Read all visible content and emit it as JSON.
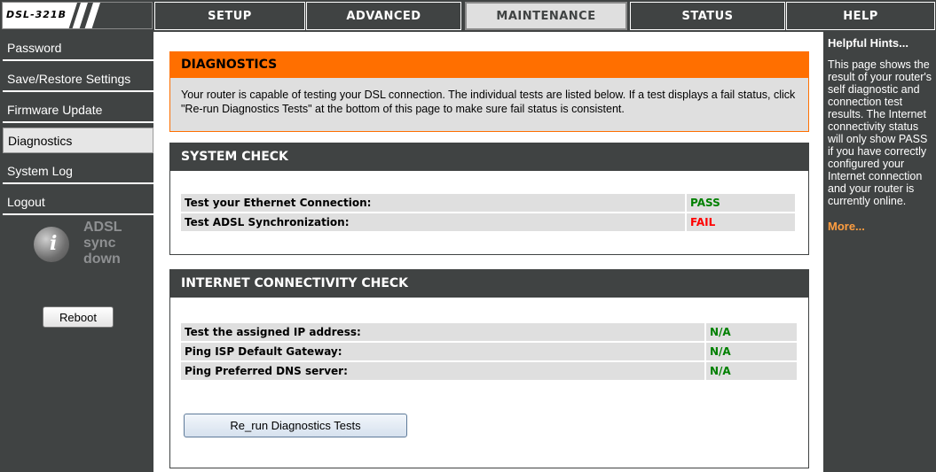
{
  "header": {
    "logo_text": "DSL-321B",
    "tabs": [
      {
        "label": "SETUP"
      },
      {
        "label": "ADVANCED"
      },
      {
        "label": "MAINTENANCE"
      },
      {
        "label": "STATUS"
      },
      {
        "label": "HELP"
      }
    ],
    "active_tab": "MAINTENANCE"
  },
  "sidebar": {
    "items": [
      {
        "label": "Password"
      },
      {
        "label": "Save/Restore Settings"
      },
      {
        "label": "Firmware Update"
      },
      {
        "label": "Diagnostics"
      },
      {
        "label": "System Log"
      },
      {
        "label": "Logout"
      }
    ],
    "active_item": "Diagnostics",
    "adsl_status": {
      "line1": "ADSL",
      "line2": "sync",
      "line3": "down"
    },
    "reboot_label": "Reboot"
  },
  "diagnostics": {
    "title": "DIAGNOSTICS",
    "description": "Your router is capable of testing your DSL connection. The individual tests are listed below. If a test displays a fail status, click \"Re-run Diagnostics Tests\" at the bottom of this page to make sure fail status is consistent."
  },
  "system_check": {
    "title": "SYSTEM CHECK",
    "rows": [
      {
        "label": "Test your Ethernet Connection:",
        "result": "PASS"
      },
      {
        "label": "Test ADSL Synchronization:",
        "result": "FAIL"
      }
    ]
  },
  "internet_check": {
    "title": "INTERNET CONNECTIVITY CHECK",
    "rows": [
      {
        "label": "Test the assigned IP address:",
        "result": "N/A"
      },
      {
        "label": "Ping ISP Default Gateway:",
        "result": "N/A"
      },
      {
        "label": "Ping Preferred DNS server:",
        "result": "N/A"
      }
    ]
  },
  "rerun_label": "Re_run Diagnostics Tests",
  "hints": {
    "title": "Helpful Hints...",
    "text": "This page shows the result of your router's self diagnostic and connection test results. The Internet connectivity status will only show PASS if you have correctly configured your Internet connection and your router is currently online.",
    "more_label": "More..."
  },
  "colors": {
    "nav_dark": "#404343",
    "accent_orange": "#ff6f00",
    "pass": "#008000",
    "fail": "#ff0000",
    "more_link": "#ff9e40"
  },
  "icons": {
    "adsl_status": "globe-info-icon"
  }
}
